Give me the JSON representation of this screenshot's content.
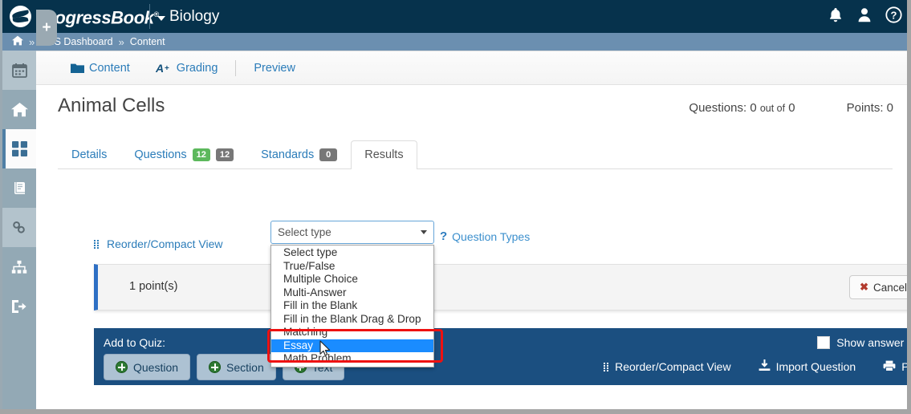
{
  "topbar": {
    "brand": "ProgressBook",
    "brand_tm": "®",
    "course": "Biology",
    "icons": [
      "bell-icon",
      "user-icon",
      "help-icon"
    ],
    "bg_color": "#06324c"
  },
  "breadcrumb": {
    "home_icon": "home-icon",
    "sep": "»",
    "items": [
      {
        "label": "LMS Dashboard"
      },
      {
        "label": "Content"
      }
    ],
    "bg_color": "#6b8fb0"
  },
  "sidebar": {
    "items": [
      {
        "icon": "calendar-icon",
        "name": "sidebar-item-calendar",
        "state": "tint"
      },
      {
        "icon": "home-icon",
        "name": "sidebar-item-home",
        "state": ""
      },
      {
        "icon": "dashboard-grid-icon",
        "name": "sidebar-item-dashboard",
        "state": "active"
      },
      {
        "icon": "gradebook-icon",
        "name": "sidebar-item-gradebook",
        "state": ""
      },
      {
        "icon": "link-icon",
        "name": "sidebar-item-links",
        "state": "tint"
      },
      {
        "icon": "sitemap-icon",
        "name": "sidebar-item-sitemap",
        "state": ""
      },
      {
        "icon": "signout-icon",
        "name": "sidebar-item-signout",
        "state": ""
      }
    ],
    "add_label": "+"
  },
  "app_tabs": [
    {
      "label": "Content",
      "icon": "folder-icon"
    },
    {
      "label": "Grading",
      "icon": "a-plus-icon"
    },
    {
      "label": "Preview",
      "icon": ""
    }
  ],
  "page": {
    "title": "Animal Cells",
    "questions_label": "Questions:",
    "questions_count": "0",
    "out_of_label": "out of",
    "questions_total": "0",
    "points_label": "Points:",
    "points_value": "0"
  },
  "result_tabs": [
    {
      "label": "Details",
      "badges": []
    },
    {
      "label": "Questions",
      "badges": [
        {
          "value": "12",
          "color": "green"
        },
        {
          "value": "12",
          "color": "grey"
        }
      ]
    },
    {
      "label": "Standards",
      "badges": [
        {
          "value": "0",
          "color": "grey"
        }
      ]
    },
    {
      "label": "Results",
      "badges": [],
      "active": true
    }
  ],
  "reorder_link": "Reorder/Compact View",
  "question_card": {
    "points": "1 point(s)",
    "cancel_label": "Cancel",
    "cancel_icon": "x-icon"
  },
  "type_select": {
    "value": "Select type",
    "options": [
      "Select type",
      "True/False",
      "Multiple Choice",
      "Multi-Answer",
      "Fill in the Blank",
      "Fill in the Blank Drag & Drop",
      "Matching",
      "Essay",
      "Math Problem"
    ],
    "selected_index": 7,
    "highlight_color": "#1a8cff"
  },
  "question_types_link": {
    "label": "Question Types",
    "icon": "question-mark-icon"
  },
  "add_panel": {
    "title": "Add to Quiz:",
    "buttons": [
      {
        "label": "Question"
      },
      {
        "label": "Section"
      },
      {
        "label": "Text"
      }
    ],
    "show_answer_key": "Show answer key",
    "links": [
      {
        "label": "Reorder/Compact View",
        "icon": "grip-icon"
      },
      {
        "label": "Import Question",
        "icon": "import-icon"
      },
      {
        "label": "Print",
        "icon": "print-icon"
      }
    ],
    "bg_color": "#1b4f80"
  },
  "annotation": {
    "shape": "rectangle",
    "color": "#ee1111"
  }
}
